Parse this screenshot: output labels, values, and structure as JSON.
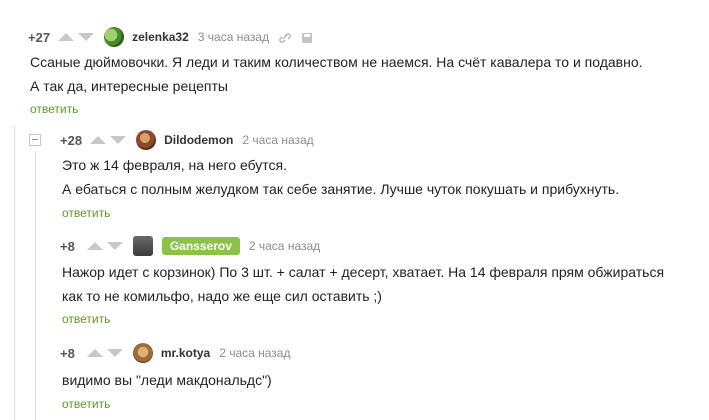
{
  "comments": [
    {
      "rating": "+27",
      "author": "zelenka32",
      "time": "3 часа назад",
      "lines": [
        "Ссаные дюймовочки. Я леди и таким количеством не наемся. На счёт кавалера то и подавно.",
        "А так да, интересные рецепты"
      ],
      "reply": "ответить"
    },
    {
      "rating": "+28",
      "author": "Dildodemon",
      "time": "2 часа назад",
      "lines": [
        "Это ж 14 февраля, на него ебутся.",
        "А ебаться с полным желудком так себе занятие. Лучше чуток покушать и прибухнуть."
      ],
      "reply": "ответить"
    },
    {
      "rating": "+8",
      "author": "Gansserov",
      "time": "2 часа назад",
      "lines": [
        "Нажор идет с корзинок) По 3 шт. + салат + десерт, хватает. На 14 февраля прям обжираться",
        "как то не комильфо, надо же еще сил оставить ;)"
      ],
      "reply": "ответить"
    },
    {
      "rating": "+8",
      "author": "mr.kotya",
      "time": "2 часа назад",
      "lines": [
        "видимо вы \"леди макдональдс\")"
      ],
      "reply": "ответить"
    }
  ],
  "colors": {
    "reply_link": "#5b9a23",
    "author_badge": "#8bc34a",
    "vote_arrow": "#c8c8c8"
  }
}
